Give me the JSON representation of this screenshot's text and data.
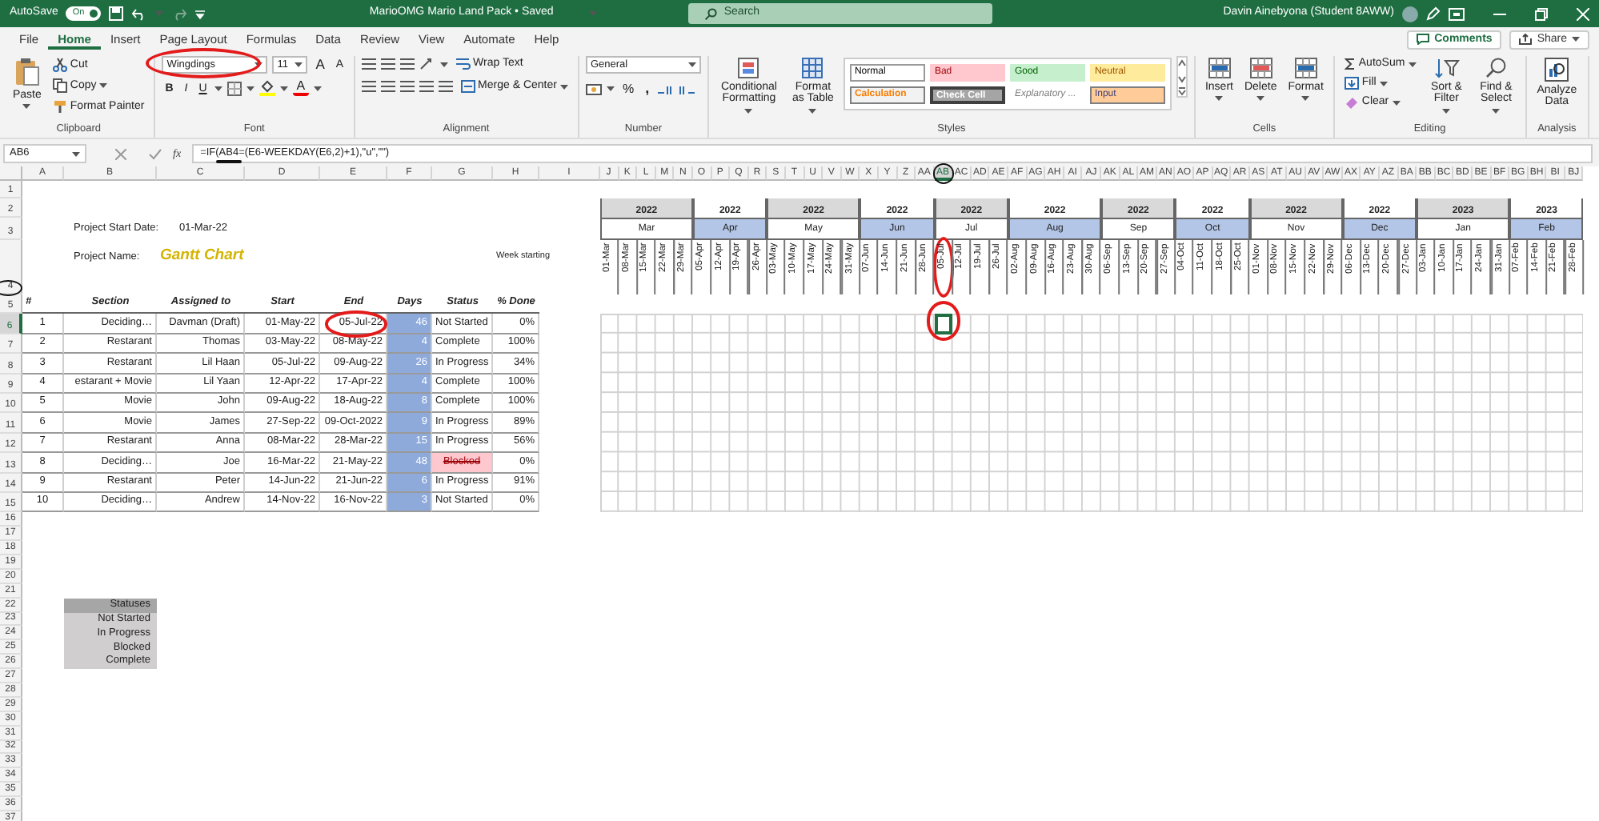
{
  "title_bar": {
    "autosave": {
      "label": "AutoSave",
      "on": true,
      "state_text": "On"
    },
    "title": "MarioOMG Mario Land Pack • Saved",
    "search": {
      "placeholder": "Search"
    },
    "user": "Davin Ainebyona (Student 8AWW)"
  },
  "tabs": [
    {
      "label": "File",
      "selected": false
    },
    {
      "label": "Home",
      "selected": true
    },
    {
      "label": "Insert",
      "selected": false
    },
    {
      "label": "Page Layout",
      "selected": false
    },
    {
      "label": "Formulas",
      "selected": false
    },
    {
      "label": "Data",
      "selected": false
    },
    {
      "label": "Review",
      "selected": false
    },
    {
      "label": "View",
      "selected": false
    },
    {
      "label": "Automate",
      "selected": false
    },
    {
      "label": "Help",
      "selected": false
    }
  ],
  "toolbar_buttons": [
    "Comments",
    "Share"
  ],
  "ribbon": {
    "groups": [
      {
        "kind": "clipboard",
        "label": "Clipboard",
        "paste": "Paste",
        "items": [
          "Cut",
          "Copy",
          "Format Painter"
        ]
      },
      {
        "kind": "font",
        "label": "Font",
        "font_name": {
          "value": "Wingdings",
          "circled": true
        },
        "font_size": "11",
        "size_buttons": [
          "A",
          "A"
        ],
        "style_buttons": [
          "B",
          "I",
          "U"
        ],
        "color_letter": "A"
      },
      {
        "kind": "alignment",
        "label": "Alignment",
        "items": [
          "Wrap Text",
          "Merge & Center"
        ]
      },
      {
        "kind": "number",
        "label": "Number",
        "format": "General",
        "symbols": [
          "%",
          ","
        ]
      },
      {
        "kind": "styles",
        "label": "Styles",
        "commands": [
          "Conditional Formatting",
          "Format as Table"
        ],
        "cell_styles": [
          {
            "label": "Normal",
            "kind": "normal"
          },
          {
            "label": "Bad",
            "kind": "bad"
          },
          {
            "label": "Good",
            "kind": "good"
          },
          {
            "label": "Neutral",
            "kind": "neutral"
          },
          {
            "label": "Calculation",
            "kind": "calculation"
          },
          {
            "label": "Check Cell",
            "kind": "check"
          },
          {
            "label": "Explanatory ...",
            "kind": "explanatory"
          },
          {
            "label": "Input",
            "kind": "input"
          }
        ]
      },
      {
        "kind": "cells",
        "label": "Cells",
        "commands": [
          "Insert",
          "Delete",
          "Format"
        ]
      },
      {
        "kind": "editing",
        "label": "Editing",
        "items": [
          "AutoSum",
          "Fill",
          "Clear"
        ],
        "commands": [
          "Sort & Filter",
          "Find & Select"
        ]
      },
      {
        "kind": "analysis",
        "label": "Analysis",
        "commands": [
          "Analyze Data"
        ]
      }
    ]
  },
  "formula_bar": {
    "name_box": "AB6",
    "function_label": "fx",
    "formula": "=IF(AB4=(E6-WEEKDAY(E6,2)+1),\"u\",\"\")",
    "reference_underlined": true
  },
  "sheet": {
    "column_headers": [
      {
        "label": "A",
        "selected": false
      },
      {
        "label": "B",
        "selected": false
      },
      {
        "label": "C",
        "selected": false
      },
      {
        "label": "D",
        "selected": false
      },
      {
        "label": "E",
        "selected": false
      },
      {
        "label": "F",
        "selected": false
      },
      {
        "label": "G",
        "selected": false
      },
      {
        "label": "H",
        "selected": false
      },
      {
        "label": "I",
        "selected": false
      },
      {
        "label": "J",
        "selected": false
      },
      {
        "label": "K",
        "selected": false
      },
      {
        "label": "L",
        "selected": false
      },
      {
        "label": "M",
        "selected": false
      },
      {
        "label": "N",
        "selected": false
      },
      {
        "label": "O",
        "selected": false
      },
      {
        "label": "P",
        "selected": false
      },
      {
        "label": "Q",
        "selected": false
      },
      {
        "label": "R",
        "selected": false
      },
      {
        "label": "S",
        "selected": false
      },
      {
        "label": "T",
        "selected": false
      },
      {
        "label": "U",
        "selected": false
      },
      {
        "label": "V",
        "selected": false
      },
      {
        "label": "W",
        "selected": false
      },
      {
        "label": "X",
        "selected": false
      },
      {
        "label": "Y",
        "selected": false
      },
      {
        "label": "Z",
        "selected": false
      },
      {
        "label": "AA",
        "selected": false
      },
      {
        "label": "AB",
        "selected": true,
        "circled": true
      },
      {
        "label": "AC",
        "selected": false
      },
      {
        "label": "AD",
        "selected": false
      },
      {
        "label": "AE",
        "selected": false
      },
      {
        "label": "AF",
        "selected": false
      },
      {
        "label": "AG",
        "selected": false
      },
      {
        "label": "AH",
        "selected": false
      },
      {
        "label": "AI",
        "selected": false
      },
      {
        "label": "AJ",
        "selected": false
      },
      {
        "label": "AK",
        "selected": false
      },
      {
        "label": "AL",
        "selected": false
      },
      {
        "label": "AM",
        "selected": false
      },
      {
        "label": "AN",
        "selected": false
      },
      {
        "label": "AO",
        "selected": false
      },
      {
        "label": "AP",
        "selected": false
      },
      {
        "label": "AQ",
        "selected": false
      },
      {
        "label": "AR",
        "selected": false
      },
      {
        "label": "AS",
        "selected": false
      },
      {
        "label": "AT",
        "selected": false
      },
      {
        "label": "AU",
        "selected": false
      },
      {
        "label": "AV",
        "selected": false
      },
      {
        "label": "AW",
        "selected": false
      },
      {
        "label": "AX",
        "selected": false
      },
      {
        "label": "AY",
        "selected": false
      },
      {
        "label": "AZ",
        "selected": false
      },
      {
        "label": "BA",
        "selected": false
      },
      {
        "label": "BB",
        "selected": false
      },
      {
        "label": "BC",
        "selected": false
      },
      {
        "label": "BD",
        "selected": false
      },
      {
        "label": "BE",
        "selected": false
      },
      {
        "label": "BF",
        "selected": false
      },
      {
        "label": "BG",
        "selected": false
      },
      {
        "label": "BH",
        "selected": false
      },
      {
        "label": "BI",
        "selected": false
      },
      {
        "label": "BJ",
        "selected": false
      }
    ],
    "row_headers": [
      {
        "label": "1",
        "selected": false
      },
      {
        "label": "2",
        "selected": false
      },
      {
        "label": "3",
        "selected": false
      },
      {
        "label": "4",
        "selected": false,
        "circled": true
      },
      {
        "label": "5",
        "selected": false
      },
      {
        "label": "6",
        "selected": true
      },
      {
        "label": "7",
        "selected": false
      },
      {
        "label": "8",
        "selected": false
      },
      {
        "label": "9",
        "selected": false
      },
      {
        "label": "10",
        "selected": false
      },
      {
        "label": "11",
        "selected": false
      },
      {
        "label": "12",
        "selected": false
      },
      {
        "label": "13",
        "selected": false
      },
      {
        "label": "14",
        "selected": false
      },
      {
        "label": "15",
        "selected": false
      },
      {
        "label": "16",
        "selected": false
      },
      {
        "label": "17",
        "selected": false
      },
      {
        "label": "18",
        "selected": false
      },
      {
        "label": "19",
        "selected": false
      },
      {
        "label": "20",
        "selected": false
      },
      {
        "label": "21",
        "selected": false
      },
      {
        "label": "22",
        "selected": false
      },
      {
        "label": "23",
        "selected": false
      },
      {
        "label": "24",
        "selected": false
      },
      {
        "label": "25",
        "selected": false
      },
      {
        "label": "26",
        "selected": false
      },
      {
        "label": "27",
        "selected": false
      },
      {
        "label": "28",
        "selected": false
      },
      {
        "label": "29",
        "selected": false
      },
      {
        "label": "30",
        "selected": false
      },
      {
        "label": "31",
        "selected": false
      },
      {
        "label": "32",
        "selected": false
      },
      {
        "label": "33",
        "selected": false
      },
      {
        "label": "34",
        "selected": false
      },
      {
        "label": "35",
        "selected": false
      },
      {
        "label": "36",
        "selected": false
      },
      {
        "label": "37",
        "selected": false
      }
    ],
    "project": {
      "start_label": "Project Start Date:",
      "start_value": "01-Mar-22",
      "name_label": "Project Name:",
      "name_value": "Gantt Chart",
      "week_label": "Week starting"
    },
    "table": {
      "columns": [
        "#",
        "Section",
        "Assigned to",
        "Start",
        "End",
        "Days",
        "Status",
        "% Done"
      ],
      "rows": [
        {
          "number": "1",
          "section": "Deciding…",
          "assigned_to": "Davman (Draft)",
          "start": "01-May-22",
          "end": "05-Jul-22",
          "end_circled": true,
          "days": "46",
          "status": "Not Started",
          "done": "0%",
          "blocked": false
        },
        {
          "number": "2",
          "section": "Restarant",
          "assigned_to": "Thomas",
          "start": "03-May-22",
          "end": "08-May-22",
          "days": "4",
          "status": "Complete",
          "done": "100%",
          "blocked": false
        },
        {
          "number": "3",
          "section": "Restarant",
          "assigned_to": "Lil Haan",
          "start": "05-Jul-22",
          "end": "09-Aug-22",
          "days": "26",
          "status": "In Progress",
          "done": "34%",
          "blocked": false
        },
        {
          "number": "4",
          "section": "estarant + Movie",
          "assigned_to": "Lil Yaan",
          "start": "12-Apr-22",
          "end": "17-Apr-22",
          "days": "4",
          "status": "Complete",
          "done": "100%",
          "blocked": false
        },
        {
          "number": "5",
          "section": "Movie",
          "assigned_to": "John",
          "start": "09-Aug-22",
          "end": "18-Aug-22",
          "days": "8",
          "status": "Complete",
          "done": "100%",
          "blocked": false
        },
        {
          "number": "6",
          "section": "Movie",
          "assigned_to": "James",
          "start": "27-Sep-22",
          "end": "09-Oct-2022",
          "days": "9",
          "status": "In Progress",
          "done": "89%",
          "blocked": false
        },
        {
          "number": "7",
          "section": "Restarant",
          "assigned_to": "Anna",
          "start": "08-Mar-22",
          "end": "28-Mar-22",
          "days": "15",
          "status": "In Progress",
          "done": "56%",
          "blocked": false
        },
        {
          "number": "8",
          "section": "Deciding…",
          "assigned_to": "Joe",
          "start": "16-Mar-22",
          "end": "21-May-22",
          "days": "48",
          "status": "Blocked",
          "done": "0%",
          "blocked": true
        },
        {
          "number": "9",
          "section": "Restarant",
          "assigned_to": "Peter",
          "start": "14-Jun-22",
          "end": "21-Jun-22",
          "days": "6",
          "status": "In Progress",
          "done": "91%",
          "blocked": false
        },
        {
          "number": "10",
          "section": "Deciding…",
          "assigned_to": "Andrew",
          "start": "14-Nov-22",
          "end": "16-Nov-22",
          "days": "3",
          "status": "Not Started",
          "done": "0%",
          "blocked": false
        }
      ]
    },
    "timeline": {
      "selected_week_circled": true,
      "months": [
        {
          "year": "2022",
          "month": "Mar",
          "highlighted": false,
          "weeks": [
            "01-Mar",
            "08-Mar",
            "15-Mar",
            "22-Mar",
            "29-Mar"
          ]
        },
        {
          "year": "2022",
          "month": "Apr",
          "highlighted": true,
          "weeks": [
            "05-Apr",
            "12-Apr",
            "19-Apr",
            "26-Apr"
          ]
        },
        {
          "year": "2022",
          "month": "May",
          "highlighted": false,
          "weeks": [
            "03-May",
            "10-May",
            "17-May",
            "24-May",
            "31-May"
          ]
        },
        {
          "year": "2022",
          "month": "Jun",
          "highlighted": true,
          "weeks": [
            "07-Jun",
            "14-Jun",
            "21-Jun",
            "28-Jun"
          ]
        },
        {
          "year": "2022",
          "month": "Jul",
          "highlighted": false,
          "weeks": [
            "05-Jul",
            "12-Jul",
            "19-Jul",
            "26-Jul"
          ]
        },
        {
          "year": "2022",
          "month": "Aug",
          "highlighted": true,
          "weeks": [
            "02-Aug",
            "09-Aug",
            "16-Aug",
            "23-Aug",
            "30-Aug"
          ]
        },
        {
          "year": "2022",
          "month": "Sep",
          "highlighted": false,
          "weeks": [
            "06-Sep",
            "13-Sep",
            "20-Sep",
            "27-Sep"
          ]
        },
        {
          "year": "2022",
          "month": "Oct",
          "highlighted": true,
          "weeks": [
            "04-Oct",
            "11-Oct",
            "18-Oct",
            "25-Oct"
          ]
        },
        {
          "year": "2022",
          "month": "Nov",
          "highlighted": false,
          "weeks": [
            "01-Nov",
            "08-Nov",
            "15-Nov",
            "22-Nov",
            "29-Nov"
          ]
        },
        {
          "year": "2022",
          "month": "Dec",
          "highlighted": true,
          "weeks": [
            "06-Dec",
            "13-Dec",
            "20-Dec",
            "27-Dec"
          ]
        },
        {
          "year": "2023",
          "month": "Jan",
          "highlighted": false,
          "weeks": [
            "03-Jan",
            "10-Jan",
            "17-Jan",
            "24-Jan",
            "31-Jan"
          ]
        },
        {
          "year": "2023",
          "month": "Feb",
          "highlighted": true,
          "weeks": [
            "07-Feb",
            "14-Feb",
            "21-Feb",
            "28-Feb"
          ]
        }
      ]
    },
    "statuses": {
      "title": "Statuses",
      "items": [
        "Not Started",
        "In Progress",
        "Blocked",
        "Complete"
      ]
    }
  }
}
